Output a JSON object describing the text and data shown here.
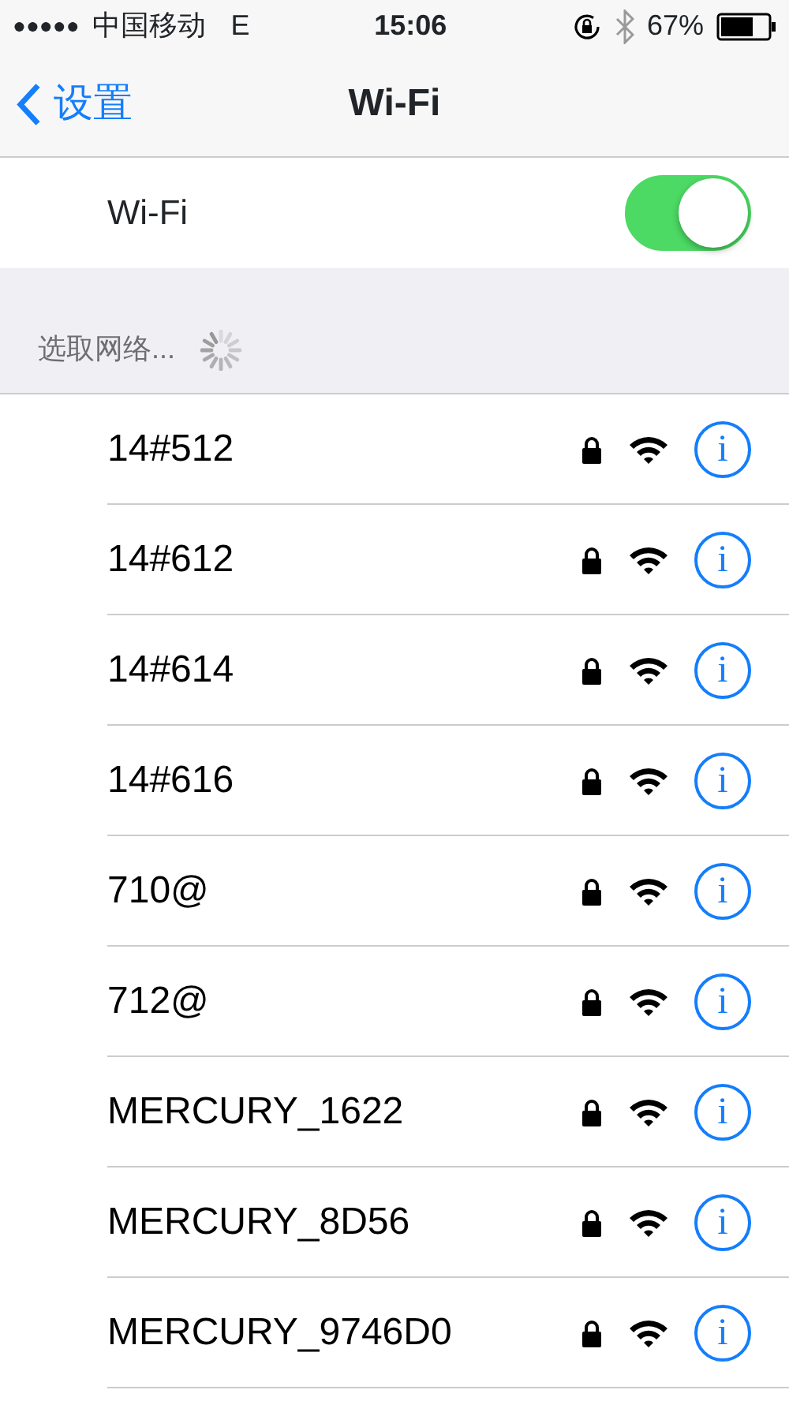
{
  "status_bar": {
    "signal_dots": "●●●●●",
    "carrier": "中国移动",
    "network": "E",
    "time": "15:06",
    "battery": "67%"
  },
  "nav": {
    "back": "设置",
    "title": "Wi-Fi"
  },
  "wifi_toggle": {
    "label": "Wi-Fi",
    "on": true
  },
  "section_header": "选取网络...",
  "networks": [
    {
      "name": "14#512",
      "locked": true,
      "info": "i"
    },
    {
      "name": "14#612",
      "locked": true,
      "info": "i"
    },
    {
      "name": "14#614",
      "locked": true,
      "info": "i"
    },
    {
      "name": "14#616",
      "locked": true,
      "info": "i"
    },
    {
      "name": "710@",
      "locked": true,
      "info": "i"
    },
    {
      "name": "712@",
      "locked": true,
      "info": "i"
    },
    {
      "name": "MERCURY_1622",
      "locked": true,
      "info": "i"
    },
    {
      "name": "MERCURY_8D56",
      "locked": true,
      "info": "i"
    },
    {
      "name": "MERCURY_9746D0",
      "locked": true,
      "info": "i"
    }
  ]
}
